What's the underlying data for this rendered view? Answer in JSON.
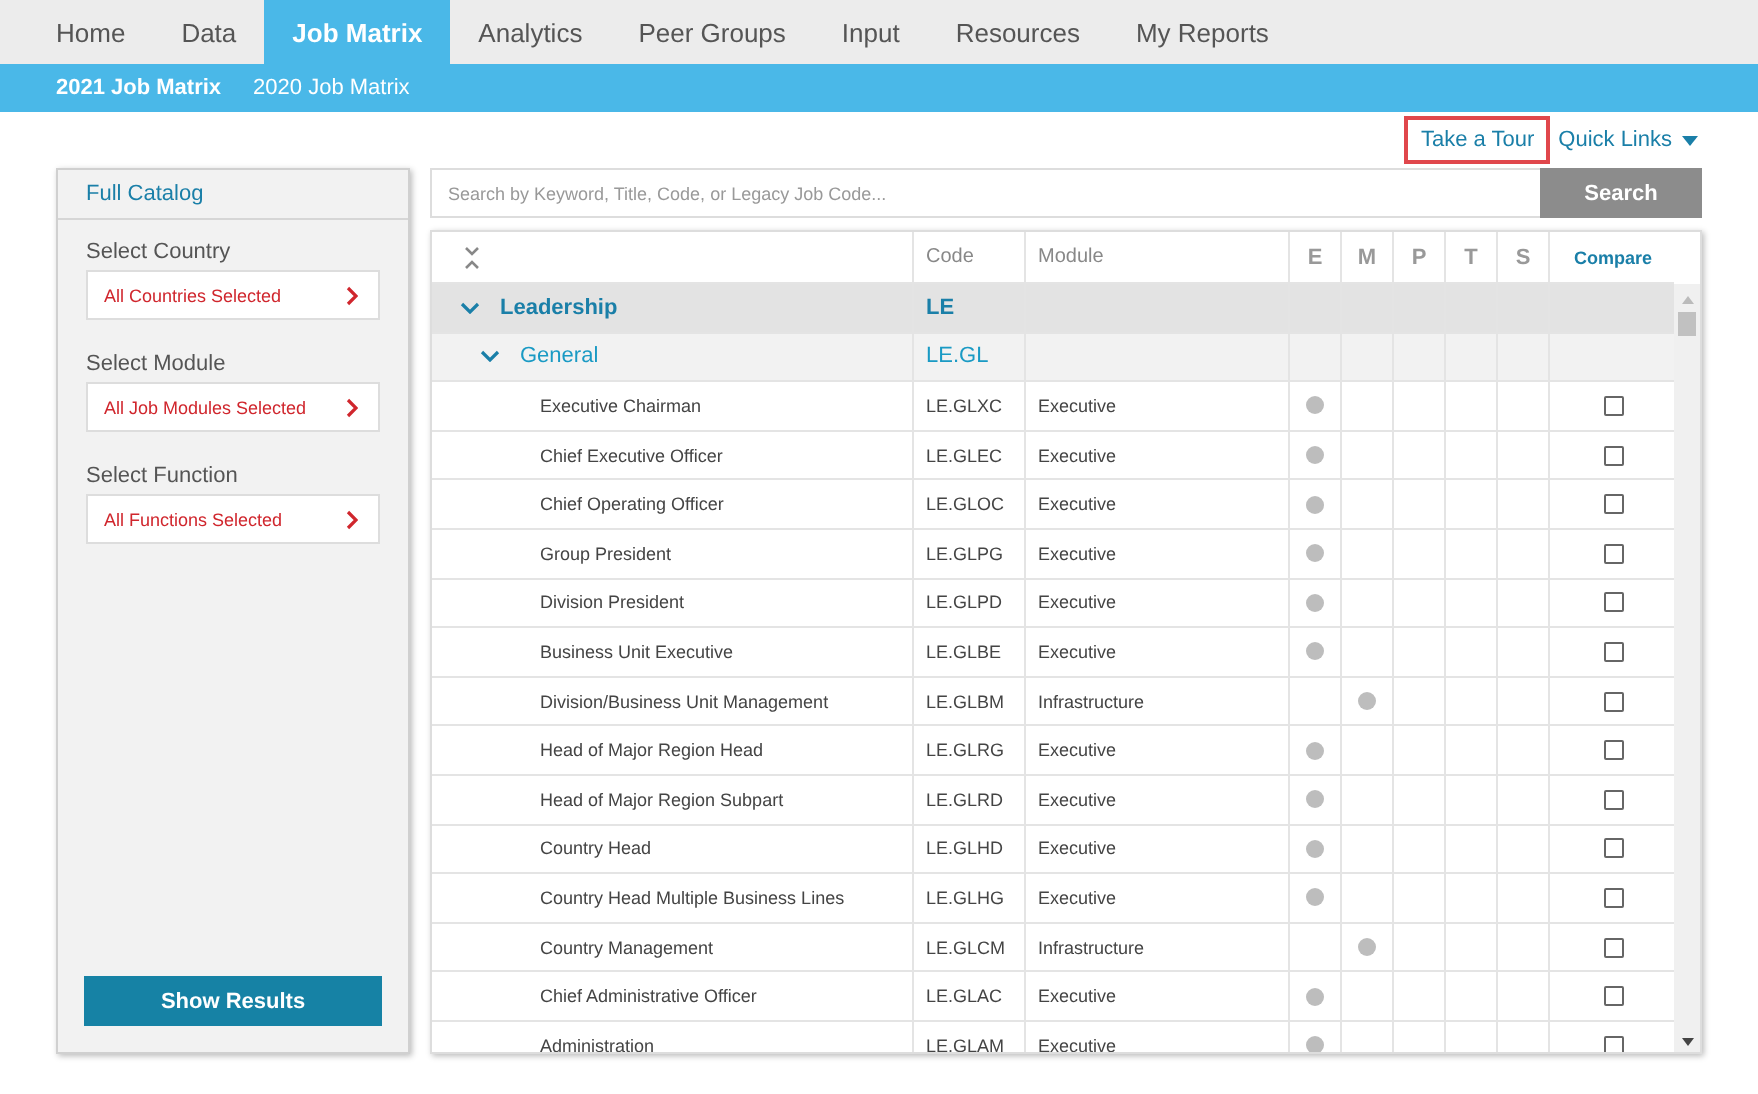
{
  "nav": {
    "tabs": [
      {
        "label": "Home",
        "selected": false
      },
      {
        "label": "Data",
        "selected": false
      },
      {
        "label": "Job Matrix",
        "selected": true
      },
      {
        "label": "Analytics",
        "selected": false
      },
      {
        "label": "Peer Groups",
        "selected": false
      },
      {
        "label": "Input",
        "selected": false
      },
      {
        "label": "Resources",
        "selected": false
      },
      {
        "label": "My Reports",
        "selected": false
      }
    ],
    "subtabs": [
      {
        "label": "2021 Job Matrix",
        "selected": true
      },
      {
        "label": "2020 Job Matrix",
        "selected": false
      }
    ]
  },
  "links": {
    "tour": {
      "label": "Take a Tour",
      "highlighted": true
    },
    "quick_links": "Quick Links"
  },
  "sidebar": {
    "title": "Full Catalog",
    "filters": [
      {
        "label": "Select Country",
        "value": "All Countries Selected"
      },
      {
        "label": "Select Module",
        "value": "All Job Modules Selected"
      },
      {
        "label": "Select Function",
        "value": "All Functions Selected"
      }
    ],
    "button": "Show Results"
  },
  "search": {
    "placeholder": "Search by Keyword, Title, Code, or Legacy Job Code...",
    "button": "Search"
  },
  "table": {
    "columns": [
      "Code",
      "Module",
      "E",
      "M",
      "P",
      "T",
      "S",
      "Compare"
    ],
    "tree": [
      {
        "name": "Leadership",
        "code": "LE",
        "expanded": true,
        "children": [
          {
            "name": "General",
            "code": "LE.GL",
            "expanded": true,
            "children": [
              {
                "name": "Executive Chairman",
                "code": "LE.GLXC",
                "module": "Executive",
                "e": true,
                "m": false,
                "checked": false
              },
              {
                "name": "Chief Executive Officer",
                "code": "LE.GLEC",
                "module": "Executive",
                "e": true,
                "m": false,
                "checked": false
              },
              {
                "name": "Chief Operating Officer",
                "code": "LE.GLOC",
                "module": "Executive",
                "e": true,
                "m": false,
                "checked": false
              },
              {
                "name": "Group President",
                "code": "LE.GLPG",
                "module": "Executive",
                "e": true,
                "m": false,
                "checked": false
              },
              {
                "name": "Division President",
                "code": "LE.GLPD",
                "module": "Executive",
                "e": true,
                "m": false,
                "checked": false
              },
              {
                "name": "Business Unit Executive",
                "code": "LE.GLBE",
                "module": "Executive",
                "e": true,
                "m": false,
                "checked": false
              },
              {
                "name": "Division/Business Unit Management",
                "code": "LE.GLBM",
                "module": "Infrastructure",
                "e": false,
                "m": true,
                "checked": false
              },
              {
                "name": "Head of Major Region Head",
                "code": "LE.GLRG",
                "module": "Executive",
                "e": true,
                "m": false,
                "checked": false
              },
              {
                "name": "Head of Major Region Subpart",
                "code": "LE.GLRD",
                "module": "Executive",
                "e": true,
                "m": false,
                "checked": false
              },
              {
                "name": "Country Head",
                "code": "LE.GLHD",
                "module": "Executive",
                "e": true,
                "m": false,
                "checked": false
              },
              {
                "name": "Country Head Multiple Business Lines",
                "code": "LE.GLHG",
                "module": "Executive",
                "e": true,
                "m": false,
                "checked": false
              },
              {
                "name": "Country Management",
                "code": "LE.GLCM",
                "module": "Infrastructure",
                "e": false,
                "m": true,
                "checked": false
              },
              {
                "name": "Chief Administrative Officer",
                "code": "LE.GLAC",
                "module": "Executive",
                "e": true,
                "m": false,
                "checked": false
              },
              {
                "name": "Administration",
                "code": "LE.GLAM",
                "module": "Executive",
                "e": true,
                "m": false,
                "checked": false
              }
            ]
          }
        ]
      }
    ]
  }
}
